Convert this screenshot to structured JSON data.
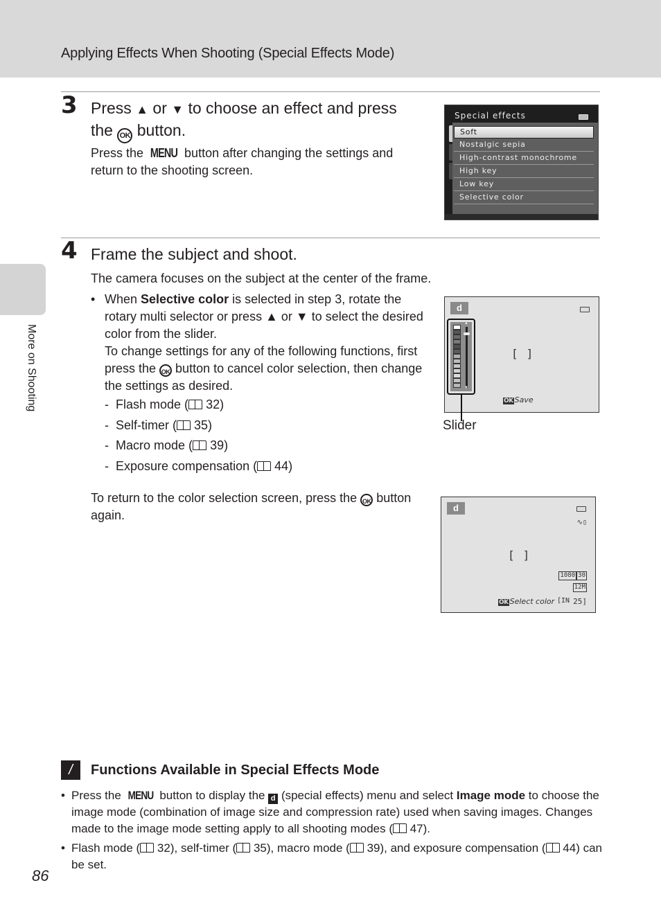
{
  "header": {
    "title": "Applying Effects When Shooting (Special Effects Mode)"
  },
  "side_tab": {
    "label": "More on Shooting"
  },
  "page_number": "86",
  "step3": {
    "number": "3",
    "title_parts": [
      "Press ",
      "▲",
      " or ",
      "▼",
      " to choose an effect and press",
      "the ",
      "OK",
      " button."
    ],
    "body_parts": [
      "Press the ",
      "MENU",
      " button after changing the settings and return to the shooting screen."
    ]
  },
  "camera_menu": {
    "title": "Special effects",
    "items": [
      {
        "label": "Soft",
        "selected": true
      },
      {
        "label": "Nostalgic sepia",
        "selected": false
      },
      {
        "label": "High-contrast monochrome",
        "selected": false
      },
      {
        "label": "High key",
        "selected": false
      },
      {
        "label": "Low key",
        "selected": false
      },
      {
        "label": "Selective color",
        "selected": false
      }
    ]
  },
  "step4": {
    "number": "4",
    "title": "Frame the subject and shoot.",
    "intro": "The camera focuses on the subject at the center of the frame.",
    "bullet": {
      "pre": "When ",
      "bold": "Selective color",
      "post1": " is selected in step 3, rotate the rotary multi selector or press ",
      "up": "▲",
      "or": " or ",
      "down": "▼",
      "post2": " to select the desired color from the slider.",
      "line2_pre": "To change settings for any of the following functions, first press the ",
      "ok": "OK",
      "line2_post": " button to cancel color selection, then change the settings as desired."
    },
    "sub_items": [
      {
        "label": "Flash mode (",
        "page": "32)"
      },
      {
        "label": "Self-timer (",
        "page": "35)"
      },
      {
        "label": "Macro mode (",
        "page": "39)"
      },
      {
        "label": "Exposure compensation (",
        "page": "44)"
      }
    ],
    "return_pre": "To return to the color selection screen, press the ",
    "return_ok": "OK",
    "return_post": " button again."
  },
  "screen1": {
    "mode_icon": "special-effects",
    "hint_ok": "OK",
    "hint_label": "Save",
    "callout": "Slider",
    "slider_swatches": [
      "#555555",
      "#6a6a6a",
      "#7a7a7a",
      "#4f4f4f",
      "#5c5c5c",
      "#b0b0b0",
      "#bdbdbd",
      "#c8c8c8",
      "#d2d2d2",
      "#dcdcdc",
      "#c4c4c4",
      "#b8b8b8"
    ],
    "slider_position": 0.1
  },
  "screen2": {
    "mode_icon": "special-effects",
    "hint_ok": "OK",
    "hint_label": "Select color",
    "movie_mode": "1080",
    "movie_fps": "30",
    "image_size": "12M",
    "memory": "IN",
    "exposures_remaining": "25"
  },
  "note": {
    "title": "Functions Available in Special Effects Mode",
    "bullet1": {
      "p1": "Press the ",
      "menu": "MENU",
      "p2": " button to display the ",
      "fx": "d",
      "p3": " (special effects) menu and select ",
      "bold": "Image mode",
      "p4": " to choose the image mode (combination of image size and compression rate) used when saving images. Changes made to the image mode setting apply to all shooting modes (",
      "p5": " 47)."
    },
    "bullet2": {
      "p1": "Flash mode (",
      "p2": " 32), self-timer (",
      "p3": " 35), macro mode (",
      "p4": " 39), and exposure compensation (",
      "p5": " 44) can be set."
    }
  }
}
